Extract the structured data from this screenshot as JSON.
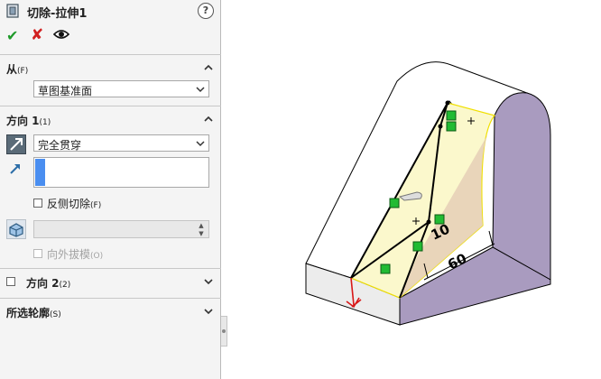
{
  "feature": {
    "title": "切除-拉伸1"
  },
  "help": {
    "label": "?"
  },
  "actions": {
    "ok_symbol": "✔",
    "cancel_symbol": "✘"
  },
  "from_section": {
    "label": "从",
    "suffix": "(F)",
    "start_condition": "草图基准面"
  },
  "direction1": {
    "label": "方向 1",
    "suffix": "(1)",
    "end_condition": "完全贯穿",
    "flip_side_label": "反侧切除",
    "flip_side_suffix": "(F)",
    "draft_outward_label": "向外拔模",
    "draft_outward_suffix": "(O)"
  },
  "direction2": {
    "label": "方向 2",
    "suffix": "(2)"
  },
  "selected_contours": {
    "label": "所选轮廓",
    "suffix": "(S)"
  },
  "model": {
    "dimension_60": "60",
    "dimension_10": "10",
    "colors": {
      "top_face": "#ffffff",
      "side_face": "#a99bbf",
      "sketch_fill": "#fbf8cc",
      "sketch_shade": "#e5cfb6",
      "sketch_edge": "#f0e000",
      "relation_marker": "#22bb33",
      "triad_red": "#d81818"
    }
  }
}
